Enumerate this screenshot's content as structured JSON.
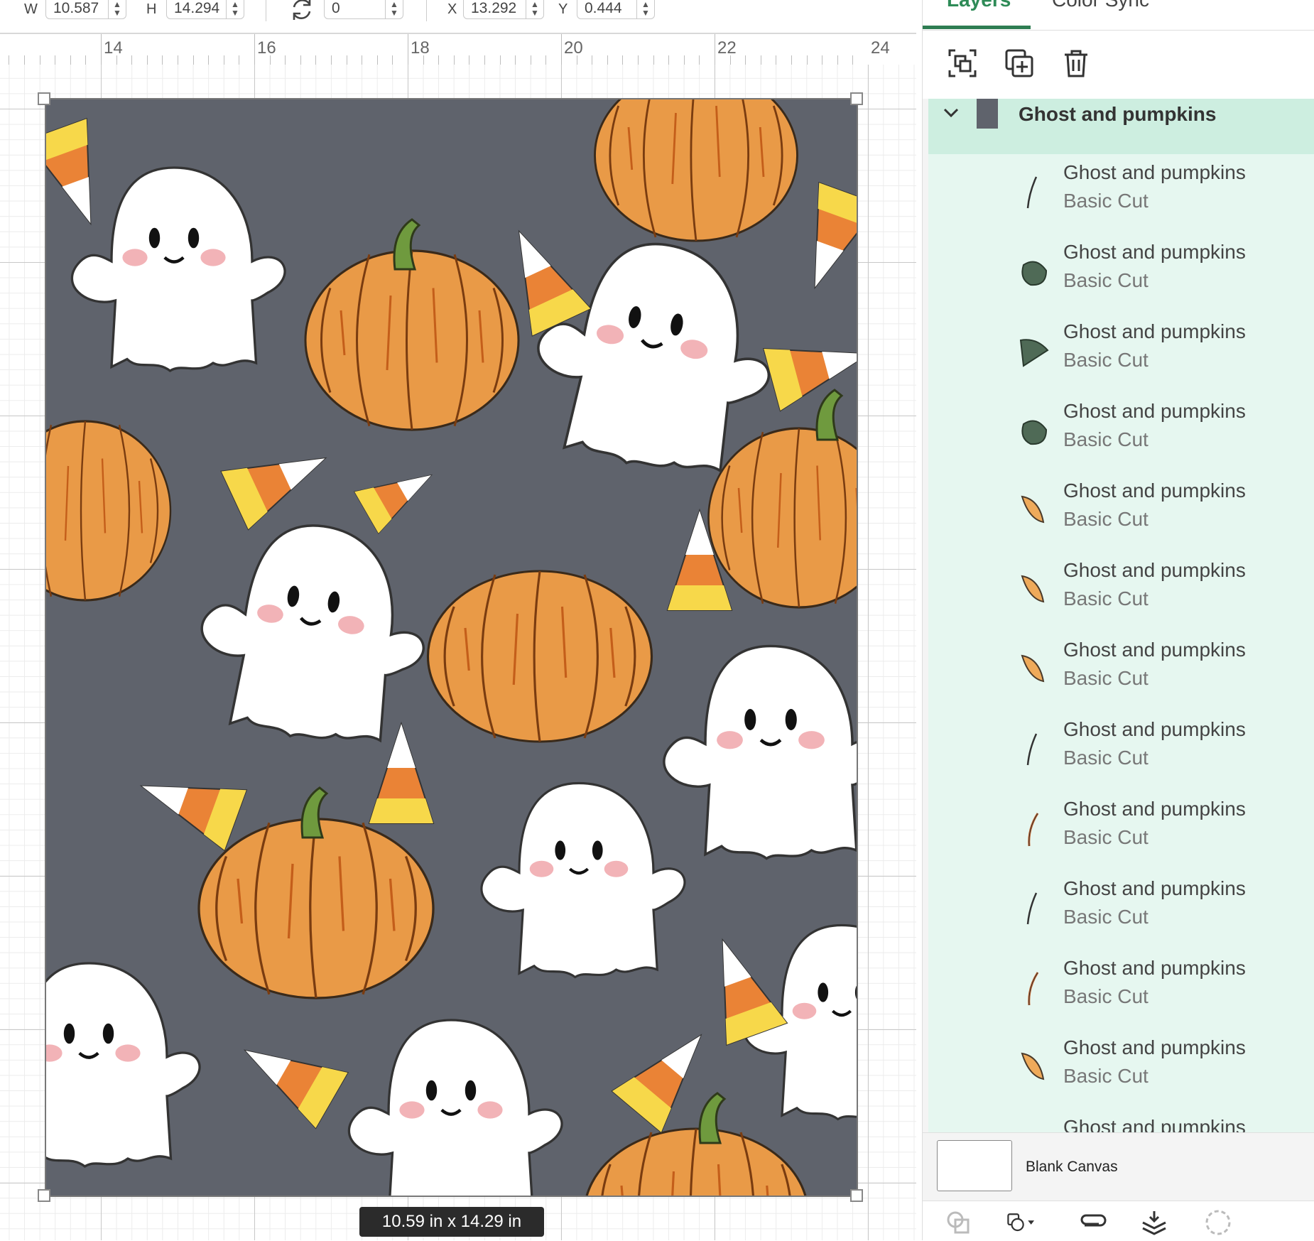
{
  "toolbar": {
    "w_label": "W",
    "w_value": "10.587",
    "h_label": "H",
    "h_value": "14.294",
    "rotate_value": "0",
    "x_label": "X",
    "x_value": "13.292",
    "y_label": "Y",
    "y_value": "0.444"
  },
  "ruler": {
    "labels": [
      "14",
      "16",
      "18",
      "20",
      "22",
      "24"
    ]
  },
  "canvas": {
    "size_label": "10.59  in x 14.29  in",
    "background_color": "#5f636c"
  },
  "panel": {
    "tabs": [
      "Layers",
      "Color Sync"
    ],
    "active_tab": "Layers",
    "accent_color": "#2e7d52",
    "group": {
      "name": "Ghost and pumpkins"
    },
    "layers": [
      {
        "name": "Ghost and pumpkins",
        "type": "Basic Cut",
        "thumb": "dark-stroke-icon"
      },
      {
        "name": "Ghost and pumpkins",
        "type": "Basic Cut",
        "thumb": "green-leaf-icon"
      },
      {
        "name": "Ghost and pumpkins",
        "type": "Basic Cut",
        "thumb": "green-wedge-icon"
      },
      {
        "name": "Ghost and pumpkins",
        "type": "Basic Cut",
        "thumb": "green-leaf-icon"
      },
      {
        "name": "Ghost and pumpkins",
        "type": "Basic Cut",
        "thumb": "orange-leaf-icon"
      },
      {
        "name": "Ghost and pumpkins",
        "type": "Basic Cut",
        "thumb": "orange-leaf-icon"
      },
      {
        "name": "Ghost and pumpkins",
        "type": "Basic Cut",
        "thumb": "orange-leaf-icon"
      },
      {
        "name": "Ghost and pumpkins",
        "type": "Basic Cut",
        "thumb": "dark-stroke-icon"
      },
      {
        "name": "Ghost and pumpkins",
        "type": "Basic Cut",
        "thumb": "orange-stroke-icon"
      },
      {
        "name": "Ghost and pumpkins",
        "type": "Basic Cut",
        "thumb": "dark-stroke-icon"
      },
      {
        "name": "Ghost and pumpkins",
        "type": "Basic Cut",
        "thumb": "orange-stroke-icon"
      },
      {
        "name": "Ghost and pumpkins",
        "type": "Basic Cut",
        "thumb": "orange-leaf-icon"
      },
      {
        "name": "Ghost and pumpkins",
        "type": "",
        "thumb": ""
      }
    ],
    "blank_canvas_label": "Blank Canvas"
  }
}
